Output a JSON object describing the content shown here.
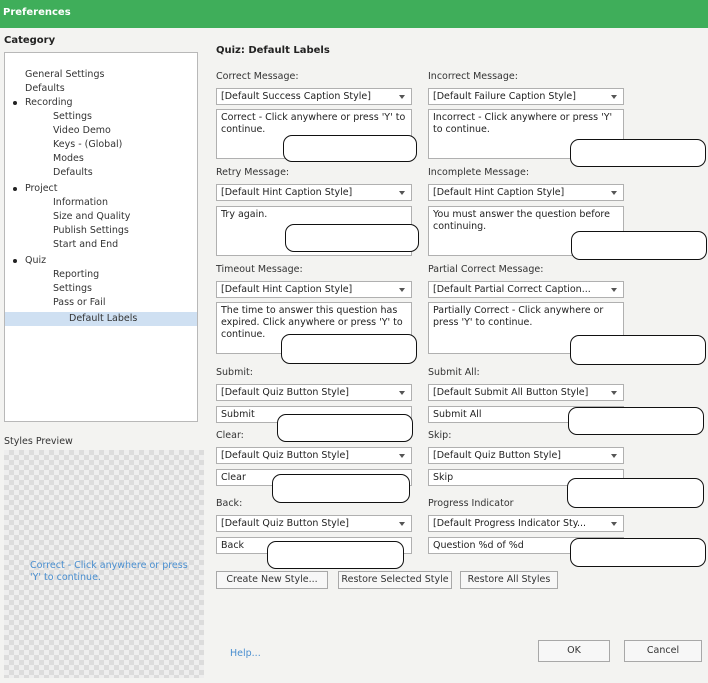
{
  "window": {
    "title": "Preferences"
  },
  "sidebar": {
    "category_label": "Category",
    "items": [
      {
        "label": "General Settings"
      },
      {
        "label": "Defaults"
      },
      {
        "label": "Recording"
      },
      {
        "label": "Settings"
      },
      {
        "label": "Video Demo"
      },
      {
        "label": "Keys - (Global)"
      },
      {
        "label": "Modes"
      },
      {
        "label": "Defaults"
      },
      {
        "label": "Project"
      },
      {
        "label": "Information"
      },
      {
        "label": "Size and Quality"
      },
      {
        "label": "Publish Settings"
      },
      {
        "label": "Start and End"
      },
      {
        "label": "Quiz"
      },
      {
        "label": "Reporting"
      },
      {
        "label": "Settings"
      },
      {
        "label": "Pass or Fail"
      },
      {
        "label": "Default Labels"
      }
    ],
    "styles_preview_label": "Styles Preview",
    "preview_text": "Correct - Click anywhere or press 'Y' to continue."
  },
  "main": {
    "title": "Quiz: Default Labels",
    "fields": {
      "correct": {
        "label": "Correct Message:",
        "style": "[Default Success Caption Style]",
        "text": "Correct - Click anywhere or press 'Y' to continue."
      },
      "incorrect": {
        "label": "Incorrect Message:",
        "style": "[Default Failure Caption Style]",
        "text": "Incorrect - Click anywhere or press 'Y' to continue."
      },
      "retry": {
        "label": "Retry Message:",
        "style": "[Default Hint Caption Style]",
        "text": "Try again."
      },
      "incomplete": {
        "label": "Incomplete Message:",
        "style": "[Default Hint Caption Style]",
        "text": "You must answer the question before continuing."
      },
      "timeout": {
        "label": "Timeout Message:",
        "style": "[Default Hint Caption Style]",
        "text": "The time to answer this question has expired. Click anywhere or press 'Y' to continue."
      },
      "partial": {
        "label": "Partial Correct Message:",
        "style": "[Default Partial Correct Caption...",
        "text": "Partially Correct - Click anywhere or press 'Y' to continue."
      },
      "submit": {
        "label": "Submit:",
        "style": "[Default Quiz Button Style]",
        "text": "Submit"
      },
      "submit_all": {
        "label": "Submit All:",
        "style": "[Default Submit All Button Style]",
        "text": "Submit All"
      },
      "clear": {
        "label": "Clear:",
        "style": "[Default Quiz Button Style]",
        "text": "Clear"
      },
      "skip": {
        "label": "Skip:",
        "style": "[Default Quiz Button Style]",
        "text": "Skip"
      },
      "back": {
        "label": "Back:",
        "style": "[Default Quiz Button Style]",
        "text": "Back"
      },
      "progress": {
        "label": "Progress Indicator",
        "style": "[Default Progress Indicator Sty...",
        "text": "Question %d of %d"
      }
    },
    "buttons": {
      "create_new_style": "Create New Style...",
      "restore_selected_style": "Restore Selected Style",
      "restore_all_styles": "Restore All Styles"
    }
  },
  "footer": {
    "help": "Help...",
    "ok": "OK",
    "cancel": "Cancel"
  }
}
